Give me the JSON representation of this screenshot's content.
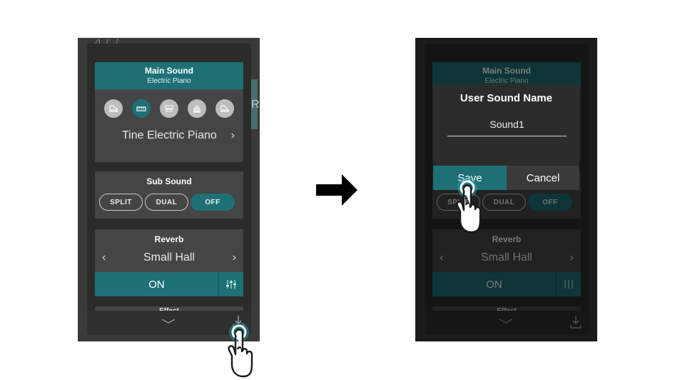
{
  "main_sound": {
    "title": "Main Sound",
    "category": "Electric Piano",
    "categories": [
      "piano",
      "electric-piano",
      "organ",
      "harpsichord",
      "other"
    ],
    "tone": "Tine Electric Piano"
  },
  "sub_sound": {
    "title": "Sub Sound",
    "modes": [
      "SPLIT",
      "DUAL",
      "OFF"
    ],
    "selected": "OFF"
  },
  "reverb": {
    "title": "Reverb",
    "type": "Small Hall",
    "state": "ON"
  },
  "effects": {
    "title": "Effect"
  },
  "background_text": "R",
  "dialog": {
    "title": "User Sound Name",
    "name_value": "Sound1",
    "save_label": "Save",
    "cancel_label": "Cancel"
  },
  "colors": {
    "accent": "#1f7076",
    "panel": "#454545",
    "sheet": "#2b2b2b"
  }
}
